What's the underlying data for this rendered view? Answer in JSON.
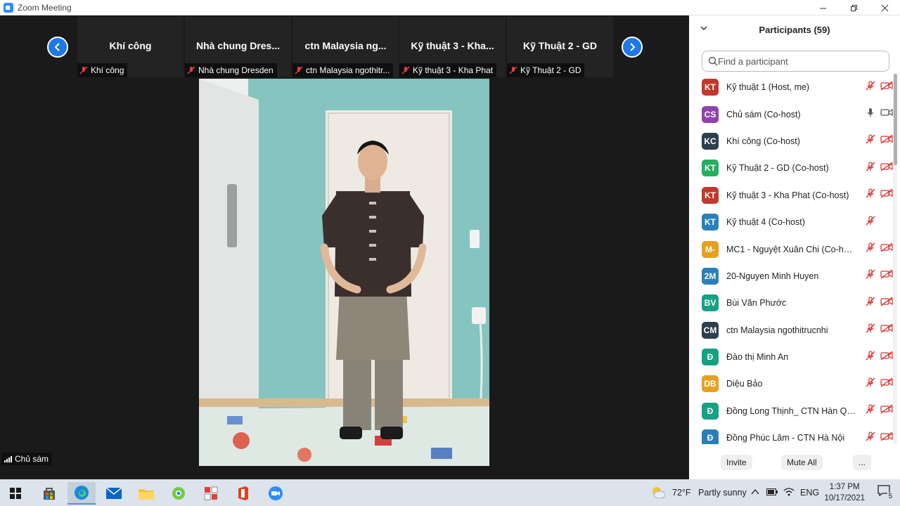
{
  "window": {
    "title": "Zoom Meeting"
  },
  "strip": {
    "tiles": [
      {
        "name": "Khí công",
        "label": "Khí công"
      },
      {
        "name": "Nhà chung Dres...",
        "label": "Nhà chung Dresden"
      },
      {
        "name": "ctn Malaysia ng...",
        "label": "ctn Malaysia ngothitr..."
      },
      {
        "name": "Kỹ thuật 3 - Kha...",
        "label": "Kỹ thuật 3 - Kha Phat"
      },
      {
        "name": "Kỹ Thuật 2 - GD",
        "label": "Kỹ Thuật 2 - GD"
      }
    ]
  },
  "active_speaker": {
    "name": "Chủ sám"
  },
  "participants": {
    "title": "Participants (59)",
    "search_placeholder": "Find a participant",
    "items": [
      {
        "initials": "KT",
        "color": "#c0392b",
        "name": "Kỹ thuật 1 (Host, me)",
        "mic": "muted",
        "video": "off"
      },
      {
        "initials": "CS",
        "color": "#8e44ad",
        "name": "Chủ sám (Co-host)",
        "mic": "on",
        "video": "on"
      },
      {
        "initials": "KC",
        "color": "#2c3e50",
        "name": "Khí công (Co-host)",
        "mic": "muted",
        "video": "off"
      },
      {
        "initials": "KT",
        "color": "#27ae60",
        "name": "Kỹ Thuật 2 - GD (Co-host)",
        "mic": "muted",
        "video": "off"
      },
      {
        "initials": "KT",
        "color": "#c0392b",
        "name": "Kỹ thuật 3 - Kha Phat (Co-host)",
        "mic": "muted",
        "video": "off"
      },
      {
        "initials": "KT",
        "color": "#2980b9",
        "name": "Kỹ thuật 4 (Co-host)",
        "mic": "muted",
        "video": "none"
      },
      {
        "initials": "M-",
        "color": "#e6a020",
        "name": "MC1 - Nguyệt Xuân Chi (Co-host)",
        "mic": "muted",
        "video": "off"
      },
      {
        "initials": "2M",
        "color": "#2980b9",
        "name": "20-Nguyen Minh Huyen",
        "mic": "muted",
        "video": "off"
      },
      {
        "initials": "BV",
        "color": "#16a085",
        "name": "Bùi Văn Phước",
        "mic": "muted",
        "video": "off"
      },
      {
        "initials": "CM",
        "color": "#2c3e50",
        "name": "ctn Malaysia ngothitrucnhi",
        "mic": "muted",
        "video": "off"
      },
      {
        "initials": "Đ",
        "color": "#16a085",
        "name": "Đào thị Minh An",
        "mic": "muted",
        "video": "off"
      },
      {
        "initials": "DB",
        "color": "#e6a020",
        "name": "Diệu Bảo",
        "mic": "muted",
        "video": "off"
      },
      {
        "initials": "Đ",
        "color": "#16a085",
        "name": "Đồng Long Thịnh_ CTN Hàn Qu...",
        "mic": "muted",
        "video": "off"
      },
      {
        "initials": "Đ",
        "color": "#2980b9",
        "name": "Đồng Phúc Lâm - CTN Hà Nội",
        "mic": "muted",
        "video": "off"
      }
    ],
    "footer": {
      "invite": "Invite",
      "mute_all": "Mute All",
      "more": "..."
    }
  },
  "taskbar": {
    "weather_temp": "72°F",
    "weather_desc": "Partly sunny",
    "language": "ENG",
    "time": "1:37 PM",
    "date": "10/17/2021",
    "notifications": "5"
  }
}
